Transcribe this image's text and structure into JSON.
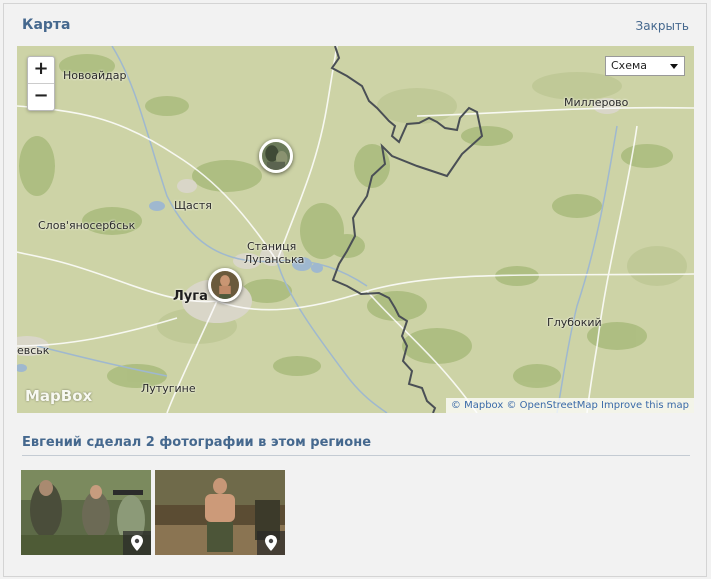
{
  "window": {
    "title": "Карта",
    "close_label": "Закрыть"
  },
  "map": {
    "zoom_in": "+",
    "zoom_out": "−",
    "layer_select": "Схема",
    "logo": "MapBox",
    "attribution": {
      "mapbox": "© Mapbox",
      "osm": "© OpenStreetMap",
      "improve": "Improve this map"
    },
    "cities": {
      "novoaidar": "Новоайдар",
      "millerovo": "Миллерово",
      "shchastia": "Щастя",
      "slovianoserbsk": "Слов'яносербськ",
      "stanytsia_1": "Станиця",
      "stanytsia_2": "Луганська",
      "luhansk": "Луга",
      "hlubokyi": "Глубокий",
      "evsk": "евськ",
      "lutuhyne": "Лутугине"
    },
    "markers": [
      "photo-marker",
      "photo-marker"
    ]
  },
  "photos": {
    "section_title": "Евгений сделал 2 фотографии в этом регионе",
    "items": [
      {
        "icon": "location-pin-icon"
      },
      {
        "icon": "location-pin-icon"
      }
    ]
  }
}
